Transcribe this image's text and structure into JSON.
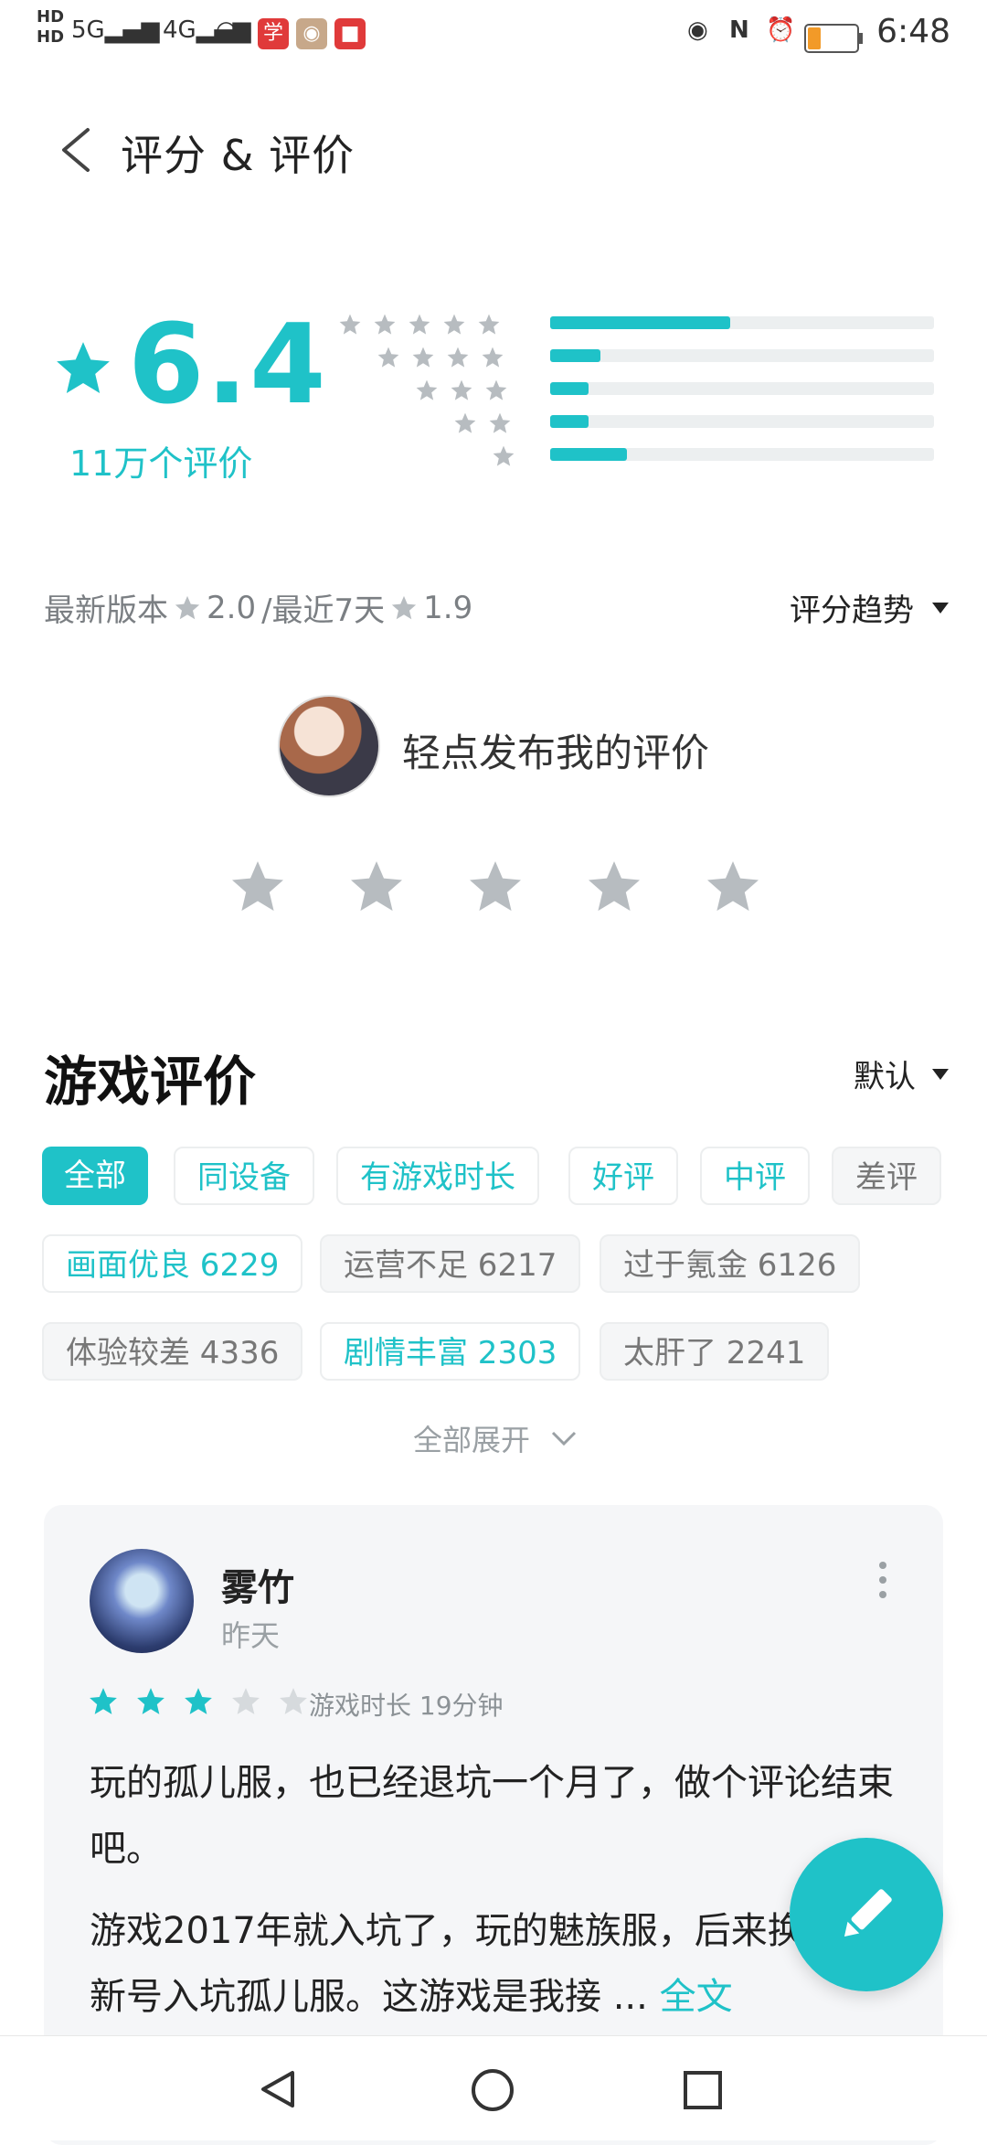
{
  "status_bar": {
    "time": "6:48",
    "indicators": [
      "HD",
      "5G",
      "4G",
      "wifi",
      "学",
      "app-icon",
      "record",
      "eye",
      "nfc",
      "alarm",
      "battery"
    ]
  },
  "header": {
    "title": "评分 & 评价"
  },
  "rating": {
    "score": "6.4",
    "count_label": "11万个评价",
    "distribution": [
      {
        "stars": 5,
        "fraction": 0.47
      },
      {
        "stars": 4,
        "fraction": 0.13
      },
      {
        "stars": 3,
        "fraction": 0.1
      },
      {
        "stars": 2,
        "fraction": 0.1
      },
      {
        "stars": 1,
        "fraction": 0.2
      }
    ]
  },
  "version": {
    "latest_label": "最新版本",
    "latest_score": "2.0",
    "separator": "/最近7天",
    "recent_score": "1.9",
    "trend_label": "评分趋势"
  },
  "publish": {
    "prompt": "轻点发布我的评价"
  },
  "reviews": {
    "section_title": "游戏评价",
    "sort_label": "默认",
    "filters": [
      "全部",
      "同设备",
      "有游戏时长",
      "好评",
      "中评",
      "差评"
    ],
    "tags": [
      "画面优良 6229",
      "运营不足 6217",
      "过于氪金 6126",
      "体验较差 4336",
      "剧情丰富 2303",
      "太肝了 2241"
    ],
    "expand_label": "全部展开"
  },
  "review_card": {
    "user": "雾竹",
    "date": "昨天",
    "stars": 3,
    "play_time": "游戏时长 19分钟",
    "paragraph1": "玩的孤儿服，也已经退坑一个月了，做个评论结束吧。",
    "paragraph2": "游戏2017年就入坑了，玩的魅族服，后来换机创新号入坑孤儿服。这游戏是我接 ... ",
    "full_text_link": "全文"
  },
  "colors": {
    "accent": "#1fc2c8",
    "gray_star": "#b7bcc0"
  }
}
